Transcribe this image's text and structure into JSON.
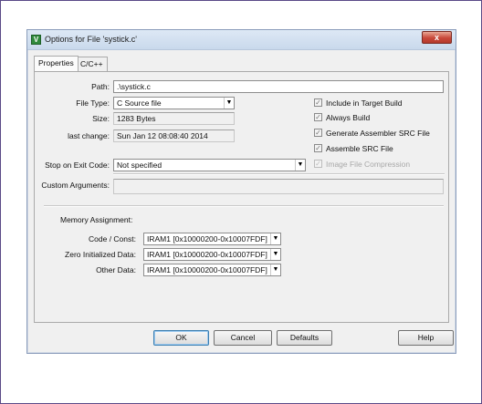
{
  "window": {
    "title": "Options for File 'systick.c'",
    "close_label": "x",
    "app_icon_glyph": "V",
    "accent": "#c9483a"
  },
  "tabs": [
    {
      "label": "Properties",
      "active": true
    },
    {
      "label": "C/C++",
      "active": false
    }
  ],
  "properties": {
    "path_label": "Path:",
    "path_value": ".\\systick.c",
    "filetype_label": "File Type:",
    "filetype_value": "C Source file",
    "size_label": "Size:",
    "size_value": "1283 Bytes",
    "lastchange_label": "last change:",
    "lastchange_value": "Sun Jan 12 08:08:40 2014",
    "stop_label": "Stop on Exit Code:",
    "stop_value": "Not specified",
    "custom_label": "Custom Arguments:",
    "custom_value": ""
  },
  "checkboxes": [
    {
      "label": "Include in Target Build",
      "checked": true,
      "disabled": false
    },
    {
      "label": "Always Build",
      "checked": true,
      "disabled": false
    },
    {
      "label": "Generate Assembler SRC File",
      "checked": true,
      "disabled": false
    },
    {
      "label": "Assemble SRC File",
      "checked": true,
      "disabled": false
    },
    {
      "label": "Image File Compression",
      "checked": true,
      "disabled": true
    }
  ],
  "memory": {
    "heading": "Memory Assignment:",
    "code_label": "Code / Const:",
    "code_value": "IRAM1 [0x10000200-0x10007FDF]",
    "zero_label": "Zero Initialized Data:",
    "zero_value": "IRAM1 [0x10000200-0x10007FDF]",
    "other_label": "Other Data:",
    "other_value": "IRAM1 [0x10000200-0x10007FDF]"
  },
  "buttons": {
    "ok": "OK",
    "cancel": "Cancel",
    "defaults": "Defaults",
    "help": "Help"
  },
  "icons": {
    "check_glyph": "✓",
    "dropdown_glyph": "▼"
  }
}
